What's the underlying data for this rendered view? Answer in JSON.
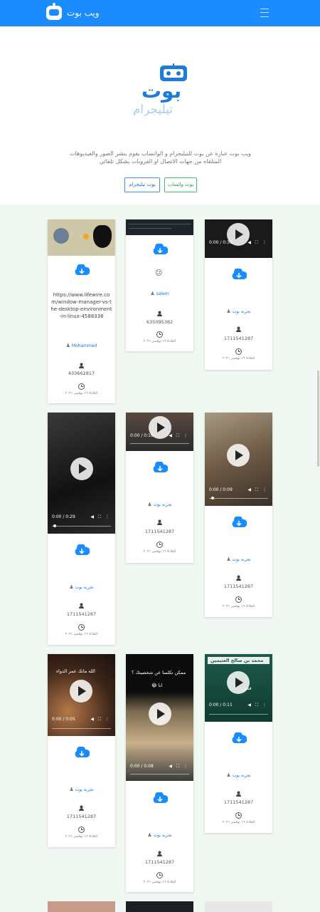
{
  "navbar": {
    "brand": "ويب بوت",
    "menu_icon": "hamburger-icon"
  },
  "hero": {
    "logo_text_top": "بوت",
    "logo_text_bottom": "تيليجرام",
    "description": "ويب بوت عبارة عن بوت للتيليجرام و الواتساب يقوم بنشر الصور والفيديوهات المتلقاه من جهات الاتصال او القروبات بشكل تلقائي",
    "whatsapp_button": "بوت واتساب",
    "telegram_button": "بوت تيليجرام"
  },
  "colors": {
    "primary": "#1a8cff",
    "green": "#3cc469",
    "page_bg": "#f1f7f2"
  },
  "cards": [
    {
      "url": "https://www.lifewire.com/window-manager-vs-the-desktop-environment-in-linux-4588338",
      "user": "Mohammed",
      "id": "433662817",
      "date": "الثلاثاء ١٦ نوفمبر ٢٠٢١"
    },
    {
      "emoji": "😕",
      "user": "salem",
      "id": "635095382",
      "date": "الثلاثاء ١٦ نوفمبر ٢٠٢١"
    },
    {
      "time": "0:00 / 0:30",
      "user": "تجربة بوت",
      "id": "1711541287",
      "date": "الثلاثاء ١٦ نوفمبر ٢٠٢١"
    },
    {
      "time": "0:00 / 0:29",
      "user": "تجربة بوت",
      "id": "1711541287",
      "date": "الثلاثاء ١٦ نوفمبر ٢٠٢١"
    },
    {
      "time": "0:00 / 0:16",
      "user": "تجربة بوت",
      "id": "1711541287",
      "date": "الثلاثاء ١٦ نوفمبر ٢٠٢١"
    },
    {
      "time": "0:00 / 0:09",
      "user": "تجربة بوت",
      "id": "1711541287",
      "date": "الثلاثاء ١٦ نوفمبر ٢٠٢١"
    },
    {
      "time": "0:00 / 0:05",
      "overlay": "الله مانك عمر الدواء",
      "user": "تجربة بوت",
      "id": "1711541287",
      "date": "الثلاثاء ١٦ نوفمبر ٢٠٢١"
    },
    {
      "time": "0:00 / 0:08",
      "overlay": "ممكن تكلمنا عن شخصيتك ؟",
      "overlay2": "انا 😂",
      "user": "تجربة بوت",
      "id": "1711541287",
      "date": "الثلاثاء ١٦ نوفمبر ٢٠٢١"
    },
    {
      "time": "0:00 / 0:11",
      "overlay": "محمد بن صالح العثيمين",
      "overlay2": "فضل",
      "user": "تجربة بوت",
      "id": "1711541287",
      "date": "الثلاثاء ١٦ نوفمبر ٢٠٢١"
    }
  ]
}
